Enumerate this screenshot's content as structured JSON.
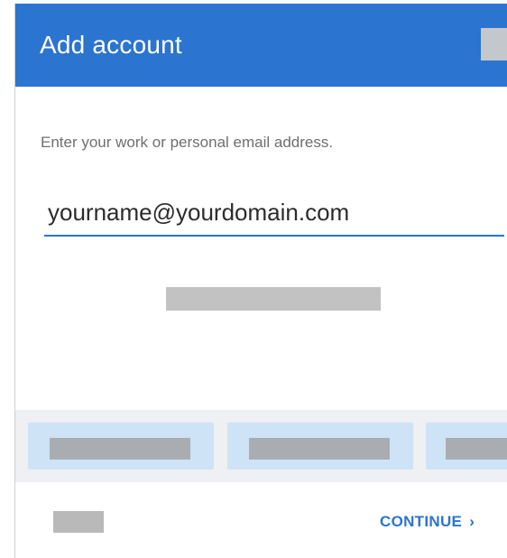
{
  "dialog": {
    "title": "Add account"
  },
  "form": {
    "prompt": "Enter your work or personal email address.",
    "email_value": "yourname@yourdomain.com"
  },
  "footer": {
    "continue_label": "CONTINUE",
    "continue_icon": "chevron-right-icon"
  },
  "colors": {
    "accent": "#2b74cf",
    "provider_button_bg": "#cfe3f6",
    "provider_area_bg": "#eef0f3"
  }
}
